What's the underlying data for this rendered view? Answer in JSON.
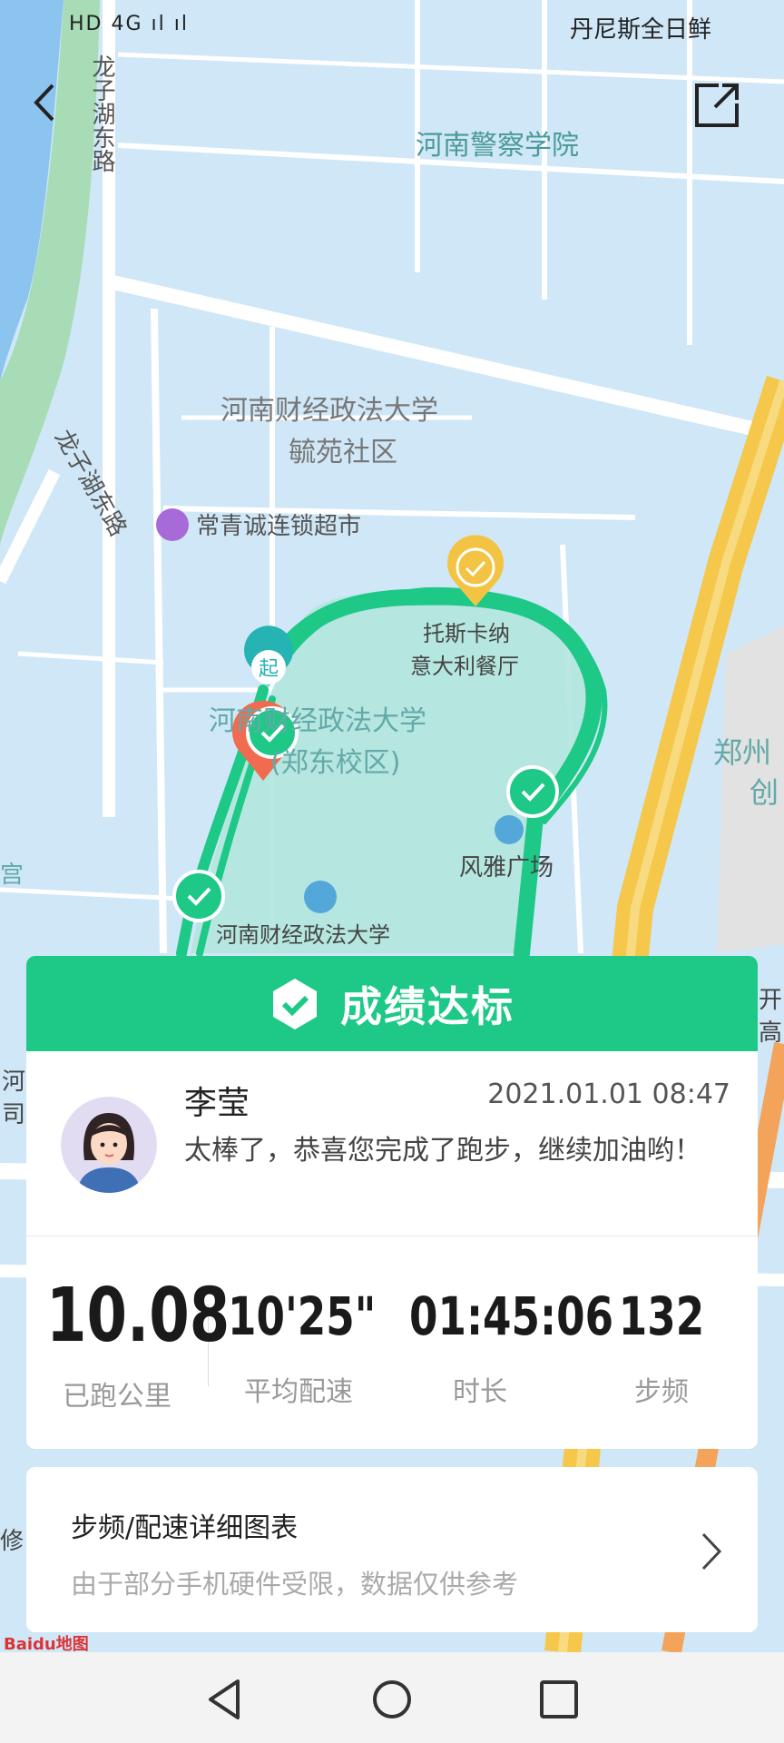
{
  "status_bar": {
    "left": "HD 4G ıl ıl",
    "right": "丹尼斯全日鲜"
  },
  "map": {
    "labels": [
      {
        "id": "road1",
        "text": "龙子湖东路"
      },
      {
        "id": "police",
        "text": "河南警察学院"
      },
      {
        "id": "campus1",
        "text": "河南财经政法大学"
      },
      {
        "id": "campus2",
        "text": "毓苑社区"
      },
      {
        "id": "market",
        "text": "常青诚连锁超市"
      },
      {
        "id": "restaurant1",
        "text": "托斯卡纳"
      },
      {
        "id": "restaurant2",
        "text": "意大利餐厅"
      },
      {
        "id": "university1",
        "text": "河南财经政法大学"
      },
      {
        "id": "university2",
        "text": "(郑东校区)"
      },
      {
        "id": "plaza",
        "text": "风雅广场"
      },
      {
        "id": "library",
        "text": "河南财经政法大学"
      },
      {
        "id": "zhengzhou",
        "text": "郑州"
      },
      {
        "id": "chuang",
        "text": "创"
      },
      {
        "id": "road2",
        "text": "龙子湖东路"
      },
      {
        "id": "kai",
        "text": "开"
      },
      {
        "id": "gao",
        "text": "高"
      },
      {
        "id": "he",
        "text": "河"
      },
      {
        "id": "si",
        "text": "司"
      },
      {
        "id": "gong",
        "text": "宫"
      },
      {
        "id": "xiu",
        "text": "修"
      }
    ],
    "start_marker": "起",
    "route_color": "#1ec887",
    "lake_color": "#8cc4f0"
  },
  "card": {
    "banner": "成绩达标",
    "user": {
      "name": "李莹",
      "datetime": "2021.01.01 08:47",
      "message": "太棒了，恭喜您完成了跑步，继续加油哟！"
    },
    "stats": [
      {
        "value": "10.08",
        "label": "已跑公里"
      },
      {
        "value": "10'25\"",
        "label": "平均配速"
      },
      {
        "value": "01:45:06",
        "label": "时长"
      },
      {
        "value": "132",
        "label": "步频"
      }
    ]
  },
  "detail": {
    "title": "步频/配速详细图表",
    "subtitle": "由于部分手机硬件受限，数据仅供参考"
  },
  "baidu_logo": "Baidu地图",
  "accent": "#1ec887",
  "icons": [
    "back-icon",
    "share-icon",
    "check-shield-icon",
    "chevron-right-icon",
    "nav-back-icon",
    "nav-home-icon",
    "nav-recent-icon"
  ]
}
